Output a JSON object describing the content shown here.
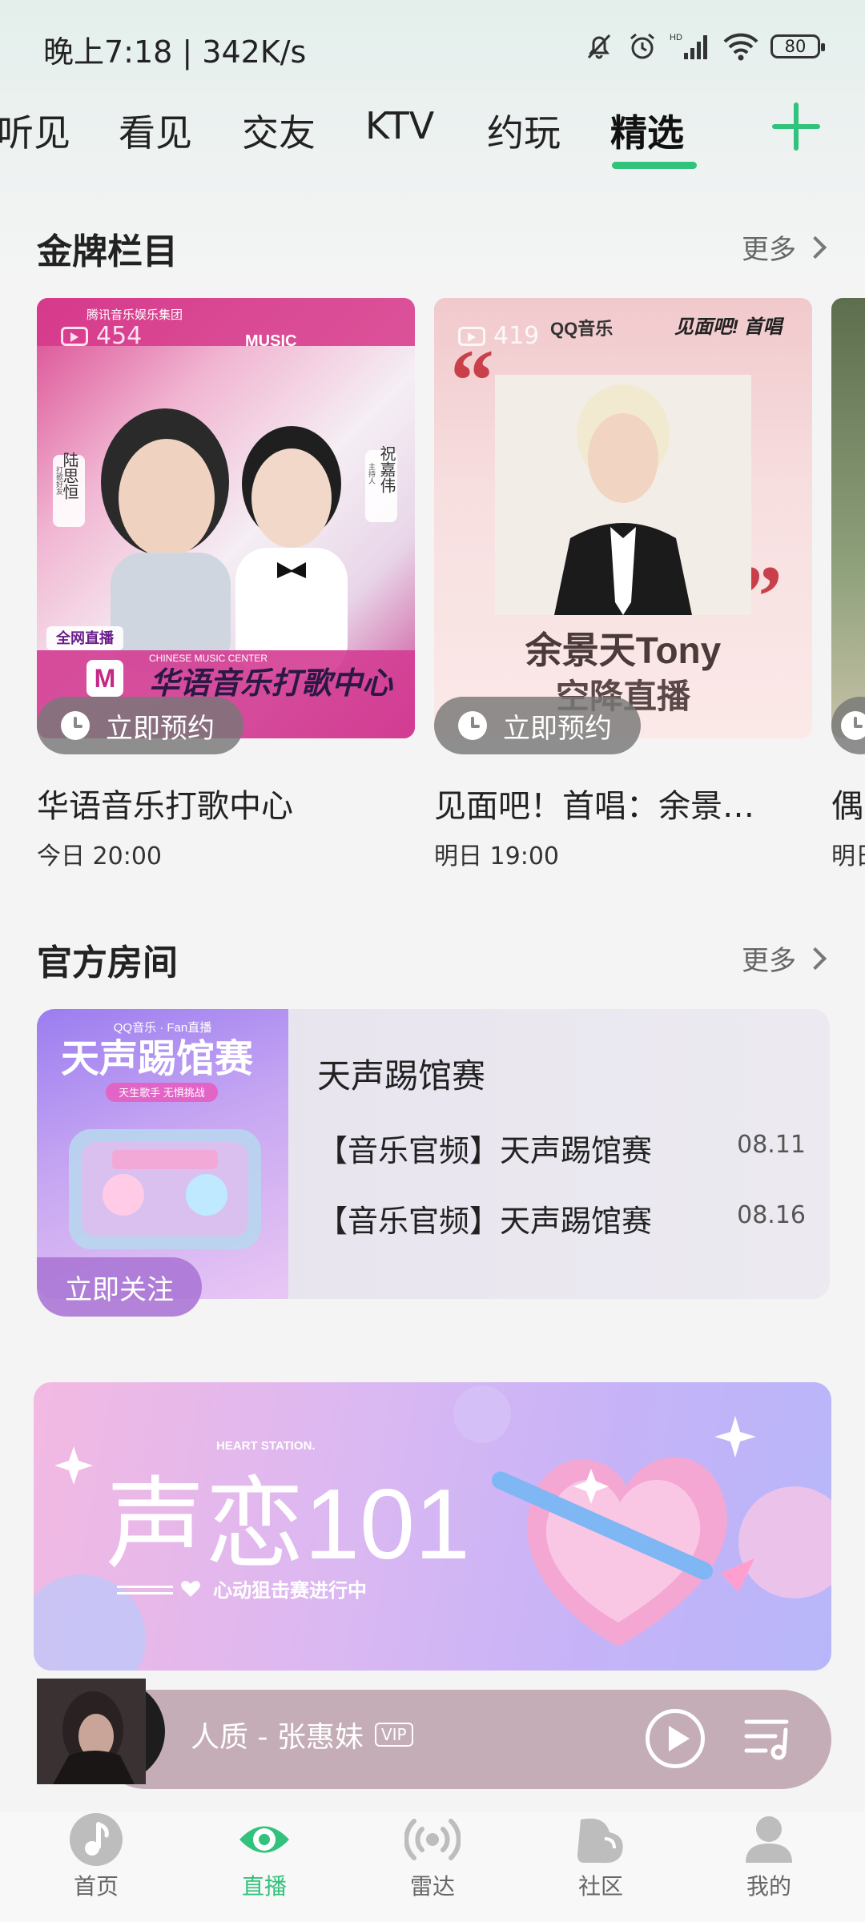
{
  "status_bar": {
    "time": "晚上7:18 | 342K/s",
    "battery": "80"
  },
  "tabs": [
    {
      "label": "听见"
    },
    {
      "label": "看见"
    },
    {
      "label": "交友"
    },
    {
      "label": "KTV"
    },
    {
      "label": "约玩"
    },
    {
      "label": "精选",
      "active": true
    }
  ],
  "sections": {
    "gold": {
      "title": "金牌栏目",
      "more": "更多"
    },
    "official": {
      "title": "官方房间",
      "more": "更多"
    }
  },
  "gold_cards": [
    {
      "views": "454",
      "reserve": "立即预约",
      "title": "华语音乐打歌中心",
      "time": "今日 20:00",
      "cover_text": {
        "group": "腾讯音乐娱乐集团",
        "music": "MUSIC",
        "logo_sub": "CHINESE MUSIC CENTER",
        "logo": "华语音乐打歌中心",
        "tag": "全网直播",
        "left_name": "陆思恒",
        "left_role": "打歌好友",
        "right_name": "祝嘉伟",
        "right_role": "主持人"
      }
    },
    {
      "views": "419",
      "reserve": "立即预约",
      "title": "见面吧！首唱：余景…",
      "time": "明日 19:00",
      "cover_text": {
        "brand": "QQ音乐",
        "show": "见面吧! 首唱",
        "name": "余景天Tony",
        "subtitle": "空降直播"
      }
    },
    {
      "title": "偶",
      "time": "明日"
    }
  ],
  "official_room": {
    "image_text": {
      "brand": "QQ音乐 · Fan直播",
      "headline": "天声踢馆赛",
      "tags": "天生歌手 无惧挑战"
    },
    "follow": "立即关注",
    "name": "天声踢馆赛",
    "rows": [
      {
        "title": "【音乐官频】天声踢馆赛",
        "date": "08.11"
      },
      {
        "title": "【音乐官频】天声踢馆赛",
        "date": "08.16"
      }
    ]
  },
  "banner": {
    "small": "HEART STATION.",
    "big": "声恋101",
    "sub": "心动狙击赛进行中"
  },
  "player": {
    "song": "人质 - 张惠妹",
    "vip": "VIP"
  },
  "nav": [
    {
      "label": "首页",
      "icon": "music-note-icon"
    },
    {
      "label": "直播",
      "icon": "eye-icon",
      "active": true
    },
    {
      "label": "雷达",
      "icon": "radar-icon"
    },
    {
      "label": "社区",
      "icon": "community-icon"
    },
    {
      "label": "我的",
      "icon": "profile-icon"
    }
  ],
  "colors": {
    "accent": "#31c27c",
    "player_bg": "#c4adb6",
    "reserve_bg": "#7a7a7a"
  }
}
